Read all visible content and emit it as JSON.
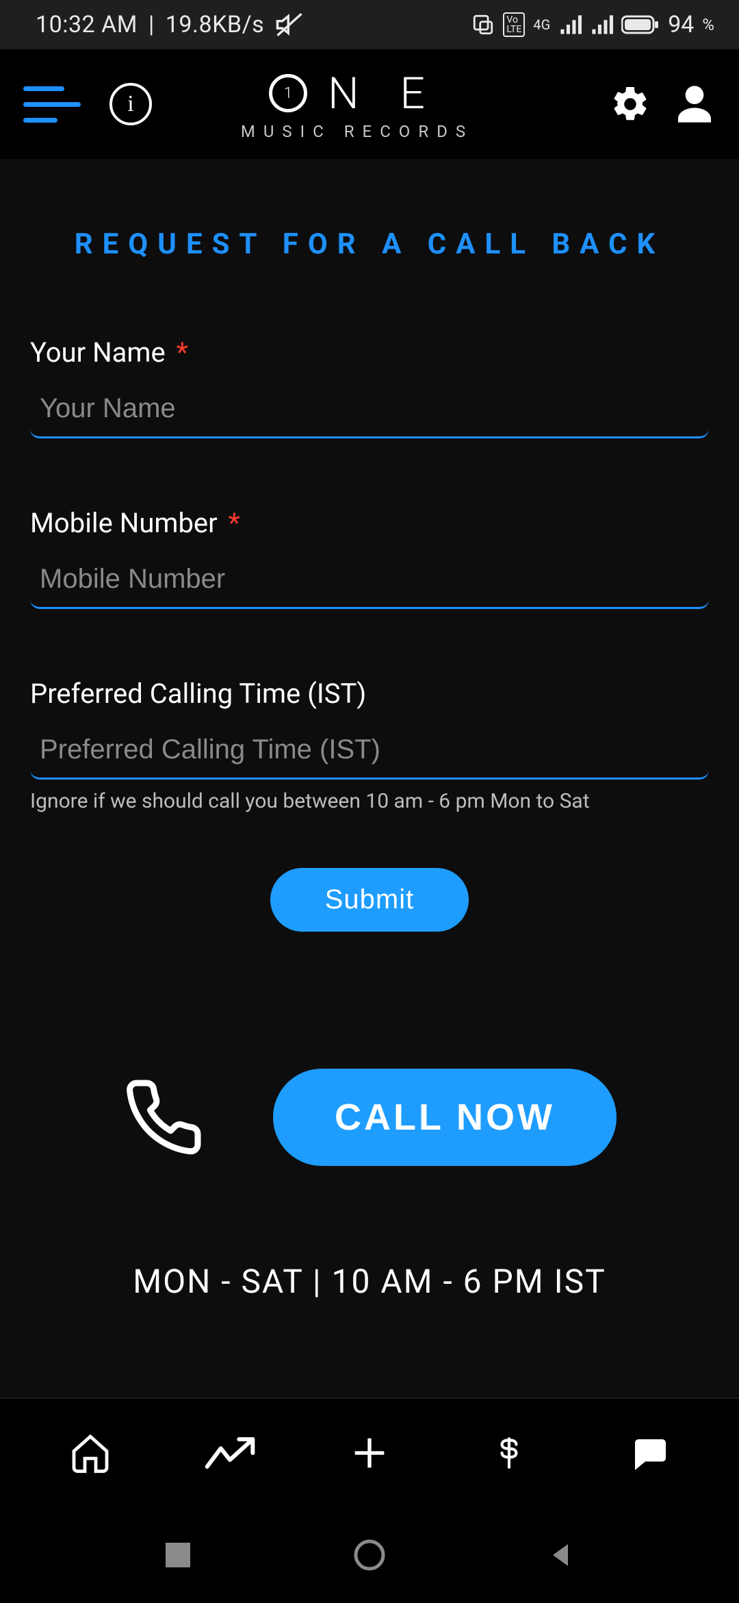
{
  "status_bar": {
    "time": "10:32 AM",
    "net_speed": "19.8KB/s",
    "network_label": "4G",
    "volte_label": "VoLTE",
    "battery_pct": "94",
    "battery_suffix": "%"
  },
  "header": {
    "brand_letters": {
      "n": "N",
      "e": "E",
      "o_digit": "1"
    },
    "brand_sub": "MUSIC RECORDS"
  },
  "page": {
    "title": "REQUEST FOR A CALL BACK",
    "hours": "MON - SAT  |  10 AM - 6 PM IST"
  },
  "form": {
    "name": {
      "label": "Your Name",
      "required": "*",
      "placeholder": "Your Name",
      "value": ""
    },
    "mobile": {
      "label": "Mobile Number",
      "required": "*",
      "placeholder": "Mobile Number",
      "value": ""
    },
    "time": {
      "label": "Preferred Calling Time (IST)",
      "placeholder": "Preferred Calling Time (IST)",
      "value": "",
      "hint": "Ignore if we should call you between 10 am - 6 pm Mon to Sat"
    },
    "submit_label": "Submit",
    "call_now_label": "CALL NOW"
  },
  "colors": {
    "accent": "#1e9dff",
    "link": "#1e90ff",
    "danger": "#ff3b30"
  }
}
